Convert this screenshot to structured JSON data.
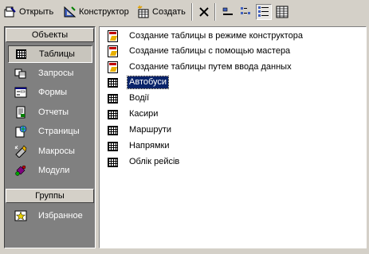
{
  "toolbar": {
    "open_label": "Открыть",
    "design_label": "Конструктор",
    "create_label": "Создать"
  },
  "left_panel": {
    "objects_header": "Объекты",
    "items": [
      {
        "label": "Таблицы",
        "icon": "table-icon",
        "selected": true
      },
      {
        "label": "Запросы",
        "icon": "query-icon"
      },
      {
        "label": "Формы",
        "icon": "form-icon"
      },
      {
        "label": "Отчеты",
        "icon": "report-icon"
      },
      {
        "label": "Страницы",
        "icon": "page-icon"
      },
      {
        "label": "Макросы",
        "icon": "macro-icon"
      },
      {
        "label": "Модули",
        "icon": "module-icon"
      }
    ],
    "groups_header": "Группы",
    "groups": [
      {
        "label": "Избранное",
        "icon": "favorites-icon"
      }
    ]
  },
  "list": {
    "items": [
      {
        "label": "Создание таблицы в режиме конструктора",
        "icon": "wizard-icon"
      },
      {
        "label": "Создание таблицы с помощью мастера",
        "icon": "wizard-icon"
      },
      {
        "label": "Создание таблицы путем ввода данных",
        "icon": "wizard-icon"
      },
      {
        "label": "Автобуси",
        "icon": "table-icon",
        "selected": true
      },
      {
        "label": "Водії",
        "icon": "table-icon"
      },
      {
        "label": "Касири",
        "icon": "table-icon"
      },
      {
        "label": "Маршрути",
        "icon": "table-icon"
      },
      {
        "label": "Напрямки",
        "icon": "table-icon"
      },
      {
        "label": "Облік рейсів",
        "icon": "table-icon"
      }
    ]
  },
  "colors": {
    "face": "#d4d0c8",
    "panel_dark": "#808080",
    "selection": "#0a246a"
  }
}
